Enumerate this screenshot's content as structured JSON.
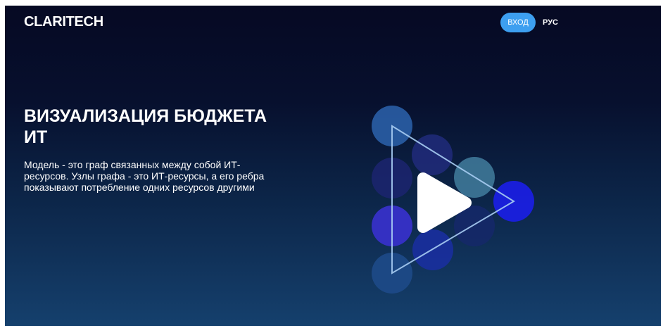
{
  "header": {
    "logo": "CLARITECH",
    "login_label": "ВХОД",
    "language_label": "РУС"
  },
  "hero": {
    "title": "ВИЗУАЛИЗАЦИЯ БЮДЖЕТА ИТ",
    "description": "Модель - это граф связанных между собой ИТ-ресурсов. Узлы графа - это ИТ-ресурсы, а его ребра показывают потребление одних ресурсов другими"
  },
  "video": {
    "icon": "play-icon"
  },
  "colors": {
    "accent": "#3d9ff0",
    "background_top": "#060923",
    "background_bottom": "#15406d"
  }
}
